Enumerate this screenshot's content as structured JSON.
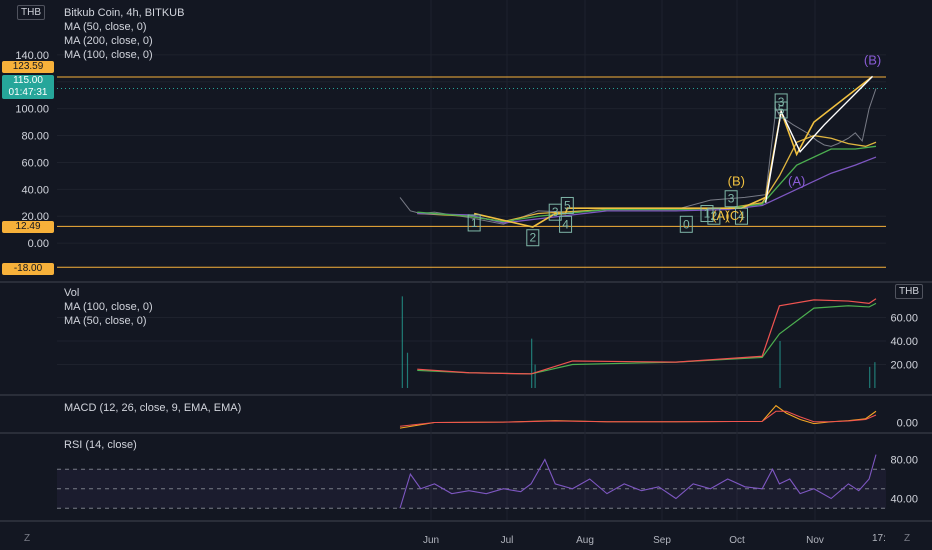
{
  "header": {
    "title": "Bitkub Coin, 4h, BITKUB",
    "currency": "THB",
    "indicators": [
      "MA (50, close, 0)",
      "MA (200, close, 0)",
      "MA (100, close, 0)"
    ]
  },
  "price_badges": {
    "current": "115.00",
    "countdown": "01:47:31",
    "upper_line": "123.59",
    "lower_line": "12.49",
    "bottom_line": "-18.00"
  },
  "volume_panel": {
    "currency": "THB",
    "indicators": [
      "Vol",
      "MA (100, close, 0)",
      "MA (50, close, 0)"
    ]
  },
  "macd_panel": {
    "title": "MACD (12, 26, close, 9, EMA, EMA)"
  },
  "rsi_panel": {
    "title": "RSI (14, close)"
  },
  "footer": {
    "left_icon": "Z",
    "time_label": "17:",
    "right_icon": "Z"
  },
  "colors": {
    "background": "#131722",
    "grid": "#1e222d",
    "price_line": "#787b86",
    "ma50": "#e0b53f",
    "ma100": "#4caf50",
    "ma200": "#7e57c2",
    "level_line": "#f7b13a",
    "current_badge": "#26a69a",
    "wave_yellow": "#f0c040",
    "wave_purple": "#8a5cd6",
    "wave_box": "#7fb7a8",
    "wave_box_red": "#e05252",
    "rsi": "#7e57c2",
    "macd": "#f5a623",
    "macd_signal": "#ef5350",
    "volume": "#26a69a"
  },
  "chart_data": [
    {
      "type": "line",
      "panel": "price",
      "title": "Bitkub Coin, 4h, BITKUB",
      "x_ticks": [
        "Jun",
        "Jul",
        "Aug",
        "Sep",
        "Oct",
        "Nov",
        "17:"
      ],
      "y_ticks": [
        0,
        20,
        40,
        60,
        80,
        100,
        120,
        140
      ],
      "ylim": [
        -20,
        160
      ],
      "grid": true,
      "levels": [
        123.59,
        12.49,
        -18.0
      ],
      "current_price": 115.0,
      "series": [
        {
          "name": "Price",
          "x": [
            0,
            0.3,
            0.6,
            1,
            2,
            3,
            4,
            5,
            6,
            7,
            8,
            9,
            10,
            10.6,
            10.9,
            11,
            11.4,
            11.8,
            12.1,
            12.3,
            12.5,
            12.7,
            13.0,
            13.2,
            13.4,
            13.6,
            13.8
          ],
          "y": [
            34,
            24,
            22,
            23,
            19,
            14,
            24,
            23,
            25,
            26,
            25,
            32,
            34,
            36,
            100,
            95,
            88,
            82,
            76,
            73,
            72,
            74,
            78,
            82,
            76,
            100,
            115
          ]
        },
        {
          "name": "MA (50, close, 0)",
          "x": [
            0.5,
            2,
            3,
            4,
            6,
            8,
            9.5,
            10.5,
            11,
            11.5,
            12,
            12.5,
            13,
            13.5,
            13.8
          ],
          "y": [
            22,
            20,
            16,
            22,
            25,
            25,
            26,
            30,
            50,
            75,
            80,
            78,
            74,
            72,
            75
          ]
        },
        {
          "name": "MA (200, close, 0)",
          "x": [
            0.5,
            2,
            3,
            4,
            6,
            8,
            9.5,
            10.5,
            11.5,
            12.5,
            13.2,
            13.8
          ],
          "y": [
            22,
            21,
            15,
            18,
            24,
            24,
            25,
            28,
            40,
            52,
            58,
            64
          ]
        },
        {
          "name": "MA (100, close, 0)",
          "x": [
            0.5,
            2,
            3,
            4,
            6,
            8,
            9.5,
            10.5,
            11.5,
            12.5,
            13.2,
            13.8
          ],
          "y": [
            23,
            20,
            16,
            20,
            25,
            25,
            26,
            29,
            58,
            70,
            70,
            72
          ]
        }
      ],
      "annotations": [
        {
          "text": "1",
          "x": 2.15,
          "y": 15
        },
        {
          "text": "2",
          "x": 3.85,
          "y": 4
        },
        {
          "text": "3",
          "x": 4.5,
          "y": 23
        },
        {
          "text": "4",
          "x": 4.8,
          "y": 14
        },
        {
          "text": "5",
          "x": 4.85,
          "y": 28
        },
        {
          "text": "0",
          "x": 8.3,
          "y": 14
        },
        {
          "text": "1",
          "x": 8.9,
          "y": 22
        },
        {
          "text": "2",
          "x": 9.1,
          "y": 20
        },
        {
          "text": "3",
          "x": 9.6,
          "y": 33
        },
        {
          "text": "4",
          "x": 9.9,
          "y": 20
        },
        {
          "text": "5",
          "x": 11.05,
          "y": 99
        },
        {
          "text": "3",
          "x": 11.05,
          "y": 105
        },
        {
          "text": "(B)",
          "x": 9.75,
          "y": 46
        },
        {
          "text": "(A)",
          "x": 9.3,
          "y": 20
        },
        {
          "text": "(C)",
          "x": 9.7,
          "y": 20
        },
        {
          "text": "(A)",
          "x": 11.5,
          "y": 46
        },
        {
          "text": "(B)",
          "x": 13.7,
          "y": 136
        }
      ]
    },
    {
      "type": "bar",
      "panel": "volume",
      "title": "Vol",
      "y_ticks": [
        20,
        40,
        60
      ],
      "ylim": [
        0,
        80
      ],
      "series": [
        {
          "name": "MA (100, close, 0)",
          "x": [
            0.5,
            2,
            3.8,
            5,
            8,
            10.5,
            11,
            12,
            13,
            13.6,
            13.8
          ],
          "y": [
            15,
            13,
            12,
            20,
            22,
            26,
            46,
            68,
            70,
            69,
            72
          ]
        },
        {
          "name": "MA (50, close, 0)",
          "x": [
            0.5,
            2,
            3.8,
            5,
            8,
            10.5,
            11,
            12,
            13,
            13.6,
            13.8
          ],
          "y": [
            16,
            13,
            12,
            23,
            22,
            27,
            70,
            75,
            74,
            72,
            76
          ]
        }
      ]
    },
    {
      "type": "line",
      "panel": "macd",
      "title": "MACD (12, 26, close, 9, EMA, EMA)",
      "y_ticks": [
        0
      ],
      "ylim": [
        -2,
        6
      ],
      "series": [
        {
          "name": "MACD",
          "x": [
            0,
            1,
            3,
            4.5,
            6,
            8,
            10.5,
            10.9,
            11.2,
            11.6,
            12,
            12.5,
            13,
            13.5,
            13.8
          ],
          "y": [
            -1.5,
            0,
            0.1,
            0.5,
            0.2,
            0.2,
            0.3,
            4.5,
            2.5,
            0.8,
            -0.3,
            0.2,
            0.5,
            1.0,
            3.0
          ]
        },
        {
          "name": "Signal",
          "x": [
            0,
            1,
            3,
            4.5,
            6,
            8,
            10.5,
            10.9,
            11.2,
            11.6,
            12,
            12.5,
            13,
            13.5,
            13.8
          ],
          "y": [
            -1.0,
            0,
            0.1,
            0.4,
            0.2,
            0.2,
            0.3,
            3.0,
            3.0,
            1.5,
            0.2,
            0.2,
            0.4,
            0.8,
            2.0
          ]
        }
      ]
    },
    {
      "type": "line",
      "panel": "rsi",
      "title": "RSI (14, close)",
      "y_ticks": [
        40,
        80
      ],
      "ylim": [
        20,
        100
      ],
      "band": [
        30,
        70
      ],
      "series": [
        {
          "name": "RSI",
          "x": [
            0,
            0.3,
            0.6,
            1,
            1.5,
            2,
            2.5,
            3,
            3.5,
            3.8,
            4.2,
            4.5,
            5,
            5.5,
            6,
            6.5,
            7,
            7.5,
            8,
            8.5,
            9,
            9.5,
            10,
            10.5,
            10.8,
            11,
            11.3,
            11.6,
            12,
            12.5,
            13,
            13.3,
            13.6,
            13.8
          ],
          "y": [
            30,
            65,
            50,
            55,
            45,
            48,
            45,
            50,
            47,
            55,
            80,
            55,
            50,
            60,
            45,
            55,
            48,
            52,
            40,
            55,
            50,
            60,
            52,
            50,
            70,
            55,
            60,
            45,
            50,
            40,
            55,
            48,
            60,
            85
          ]
        }
      ]
    }
  ]
}
